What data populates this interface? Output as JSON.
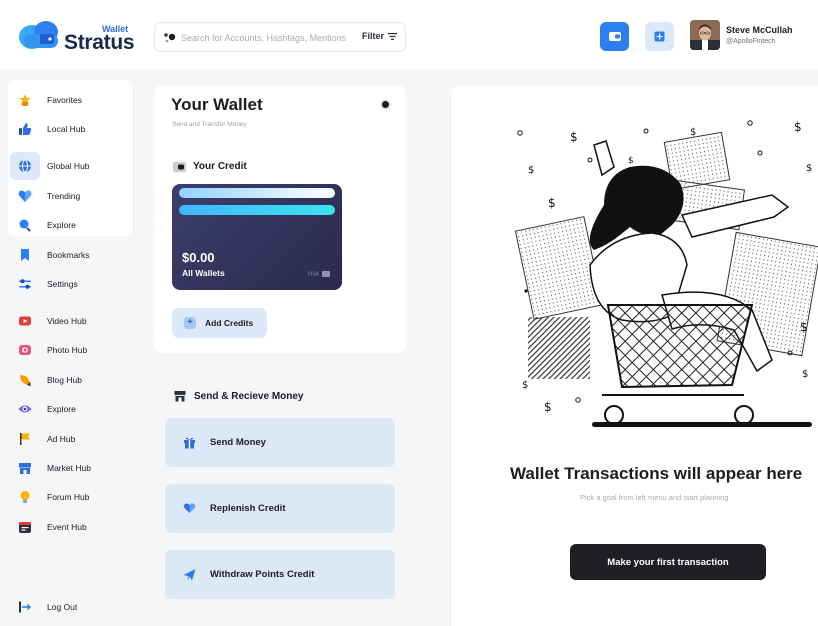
{
  "brand": {
    "sub": "Wallet",
    "name": "Stratus"
  },
  "search": {
    "placeholder": "Search for Accounts, Hashtags, Mentions",
    "filter_label": "Filter"
  },
  "user": {
    "name": "Steve McCullah",
    "handle": "@ApolloFintech"
  },
  "sidebar": {
    "items": [
      {
        "label": "Favorites",
        "icon": "star-hand-icon",
        "color": "#f5b400"
      },
      {
        "label": "Local Hub",
        "icon": "thumbs-up-icon",
        "color": "#2d6fe0"
      },
      {
        "label": "Global Hub",
        "icon": "globe-icon",
        "color": "#2d6fe0"
      },
      {
        "label": "Trending",
        "icon": "heart-icon",
        "color": "#2d7ef0"
      },
      {
        "label": "Explore",
        "icon": "search-icon",
        "color": "#2d7ef0"
      },
      {
        "label": "Bookmarks",
        "icon": "bookmark-icon",
        "color": "#2d7ef0"
      },
      {
        "label": "Settings",
        "icon": "sliders-icon",
        "color": "#2d7ef0"
      },
      {
        "label": "Video Hub",
        "icon": "video-icon",
        "color": "#e53a3a"
      },
      {
        "label": "Photo Hub",
        "icon": "camera-icon",
        "color": "#ef4f7c"
      },
      {
        "label": "Blog Hub",
        "icon": "pen-icon",
        "color": "#f5a000"
      },
      {
        "label": "Explore",
        "icon": "eye-icon",
        "color": "#7a5af5"
      },
      {
        "label": "Ad Hub",
        "icon": "flag-icon",
        "color": "#2c2f36"
      },
      {
        "label": "Market Hub",
        "icon": "store-icon",
        "color": "#2d6fe0"
      },
      {
        "label": "Forum Hub",
        "icon": "lightbulb-icon",
        "color": "#f5b400"
      },
      {
        "label": "Event Hub",
        "icon": "calendar-icon",
        "color": "#2c2f36"
      }
    ],
    "logout_label": "Log Out"
  },
  "wallet": {
    "title": "Your Wallet",
    "subtitle": "Send and Transfer Money",
    "credit_label": "Your Credit",
    "card_amount": "$0.00",
    "card_label": "All Wallets",
    "card_brand": "VISA",
    "add_credits_label": "Add Credits"
  },
  "transfer": {
    "heading": "Send & Recieve Money",
    "actions": [
      {
        "label": "Send Money",
        "icon": "gift-icon"
      },
      {
        "label": "Replenish Credit",
        "icon": "heart-hand-icon"
      },
      {
        "label": "Withdraw Points Credit",
        "icon": "paper-plane-icon"
      }
    ]
  },
  "empty_state": {
    "title": "Wallet Transactions will appear here",
    "subtitle": "Pick a goal  from left menu and start planning",
    "cta_label": "Make your first transaction"
  }
}
